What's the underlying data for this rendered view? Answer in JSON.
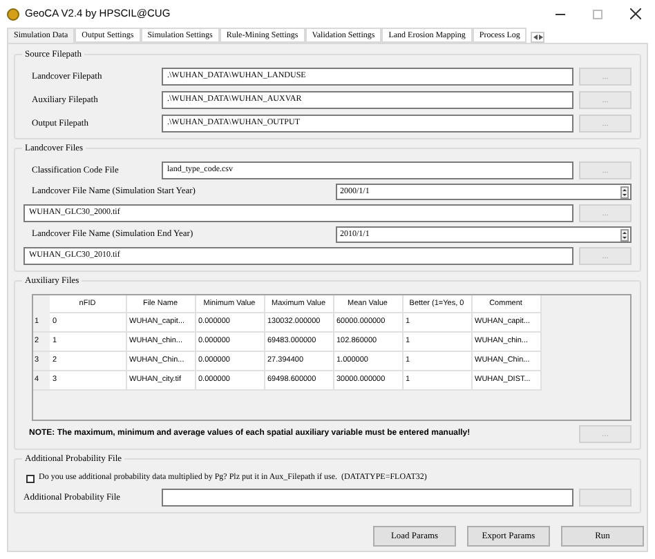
{
  "window": {
    "title": "GeoCA V2.4 by HPSCIL@CUG"
  },
  "tabs": [
    {
      "label": "Simulation Data",
      "selected": true
    },
    {
      "label": "Output Settings",
      "selected": false
    },
    {
      "label": "Simulation Settings",
      "selected": false
    },
    {
      "label": "Rule-Mining Settings",
      "selected": false
    },
    {
      "label": "Validation Settings",
      "selected": false
    },
    {
      "label": "Land Erosion Mapping",
      "selected": false
    },
    {
      "label": "Process Log",
      "selected": false
    }
  ],
  "source_filepath": {
    "title": "Source Filepath",
    "rows": [
      {
        "label": "Landcover Filepath",
        "value": ".\\WUHAN_DATA\\WUHAN_LANDUSE",
        "browse": {
          "label": "...",
          "disabled": true
        }
      },
      {
        "label": "Auxiliary Filepath",
        "value": ".\\WUHAN_DATA\\WUHAN_AUXVAR",
        "browse": {
          "label": "...",
          "disabled": true
        }
      },
      {
        "label": "Output Filepath",
        "value": ".\\WUHAN_DATA\\WUHAN_OUTPUT",
        "browse": {
          "label": "...",
          "disabled": true
        }
      }
    ]
  },
  "landcover_files": {
    "title": "Landcover Files",
    "classification": {
      "label": "Classification Code File",
      "value": "land_type_code.csv",
      "browse": {
        "label": "...",
        "disabled": true
      }
    },
    "years": [
      {
        "label": "Landcover File Name (Simulation Start Year)",
        "date": "2000/1/1",
        "file": "WUHAN_GLC30_2000.tif",
        "browse": {
          "label": "...",
          "disabled": true
        }
      },
      {
        "label": "Landcover File Name (Simulation End Year)",
        "date": "2010/1/1",
        "file": "WUHAN_GLC30_2010.tif",
        "browse": {
          "label": "...",
          "disabled": true
        }
      }
    ]
  },
  "auxiliary_files": {
    "title": "Auxiliary Files",
    "table": {
      "columns": [
        "nFID",
        "File Name",
        "Minimum Value",
        "Maximum Value",
        "Mean Value",
        "Better (1=Yes, 0",
        "Comment"
      ],
      "rows": [
        {
          "index": "1",
          "cells": [
            "0",
            "WUHAN_capit...",
            "0.000000",
            "130032.000000",
            "60000.000000",
            "1",
            "WUHAN_capit..."
          ]
        },
        {
          "index": "2",
          "cells": [
            "1",
            "WUHAN_chin...",
            "0.000000",
            "69483.000000",
            "102.860000",
            "1",
            "WUHAN_chin..."
          ]
        },
        {
          "index": "3",
          "cells": [
            "2",
            "WUHAN_Chin...",
            "0.000000",
            "27.394400",
            "1.000000",
            "1",
            "WUHAN_Chin..."
          ]
        },
        {
          "index": "4",
          "cells": [
            "3",
            "WUHAN_city.tif",
            "0.000000",
            "69498.600000",
            "30000.000000",
            "1",
            "WUHAN_DIST..."
          ]
        }
      ]
    },
    "note": "NOTE: The maximum, minimum and average values of each spatial auxiliary variable must be entered manually!",
    "browse": {
      "label": "...",
      "disabled": true
    }
  },
  "additional_probability": {
    "title": "Additional Probability File",
    "checkbox": {
      "label": "Do you use additional probability data multiplied by Pg? Plz put it in Aux_Filepath if use.  (DATATYPE=FLOAT32)",
      "checked": false
    },
    "file": {
      "label": "Additional Probability File",
      "browse": {
        "disabled": true
      }
    }
  },
  "buttons": [
    "Load Params",
    "Export Params",
    "Run"
  ]
}
